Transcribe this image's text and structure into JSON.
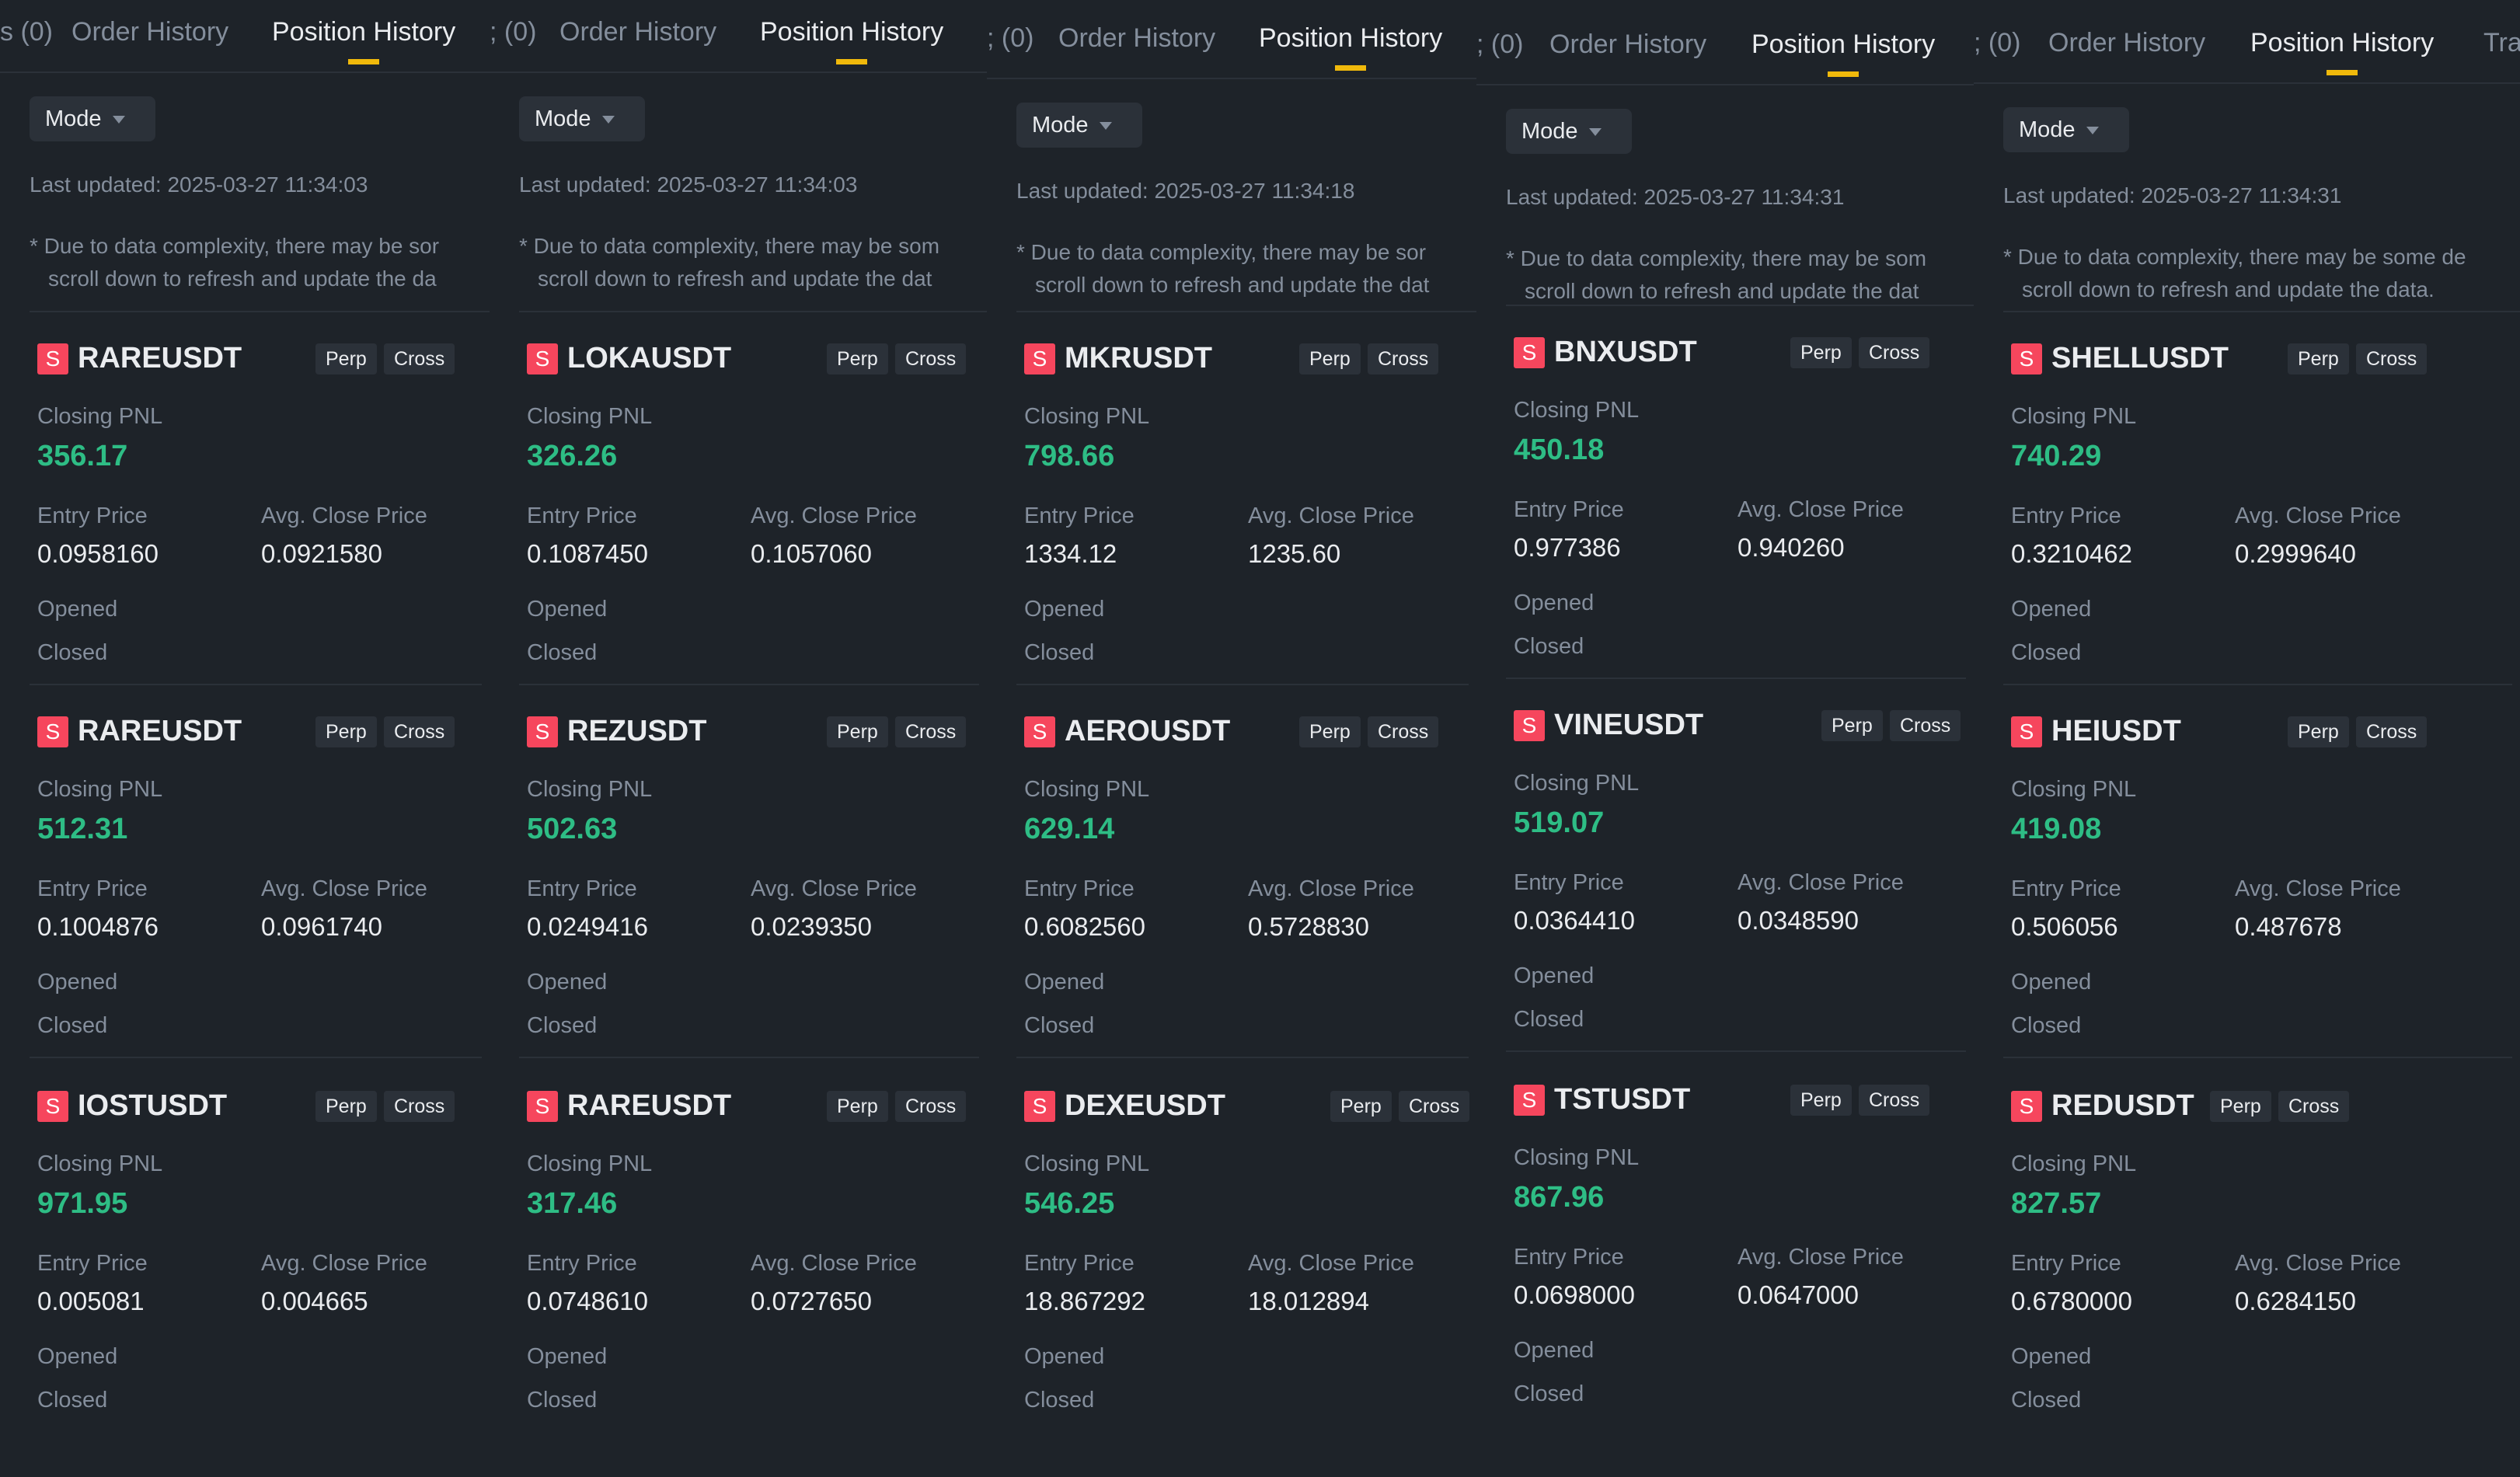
{
  "columns": [
    {
      "tabs": {
        "prev": "s (0)",
        "order": "Order History",
        "position": "Position History",
        "next": ""
      },
      "mode": "Mode",
      "updated": "Last updated: 2025-03-27 11:34:03",
      "note1": "* Due to data complexity, there may be sor",
      "note2": "scroll down to refresh and update the da",
      "cards": [
        {
          "symbol": "RAREUSDT",
          "perp": "Perp",
          "cross": "Cross",
          "closing_pnl_label": "Closing PNL",
          "pnl": "356.17",
          "entry_label": "Entry Price",
          "avg_label": "Avg. Close Price",
          "entry": "0.0958160",
          "avg": "0.0921580",
          "opened": "Opened",
          "closed": "Closed"
        },
        {
          "symbol": "RAREUSDT",
          "perp": "Perp",
          "cross": "Cross",
          "closing_pnl_label": "Closing PNL",
          "pnl": "512.31",
          "entry_label": "Entry Price",
          "avg_label": "Avg. Close Price",
          "entry": "0.1004876",
          "avg": "0.0961740",
          "opened": "Opened",
          "closed": "Closed"
        },
        {
          "symbol": "IOSTUSDT",
          "perp": "Perp",
          "cross": "Cross",
          "closing_pnl_label": "Closing PNL",
          "pnl": "971.95",
          "entry_label": "Entry Price",
          "avg_label": "Avg. Close Price",
          "entry": "0.005081",
          "avg": "0.004665",
          "opened": "Opened",
          "closed": "Closed"
        }
      ]
    },
    {
      "tabs": {
        "prev": "; (0)",
        "order": "Order History",
        "position": "Position History",
        "next": ""
      },
      "mode": "Mode",
      "updated": "Last updated: 2025-03-27 11:34:03",
      "note1": "* Due to data complexity, there may be som",
      "note2": "scroll down to refresh and update the dat",
      "cards": [
        {
          "symbol": "LOKAUSDT",
          "perp": "Perp",
          "cross": "Cross",
          "closing_pnl_label": "Closing PNL",
          "pnl": "326.26",
          "entry_label": "Entry Price",
          "avg_label": "Avg. Close Price",
          "entry": "0.1087450",
          "avg": "0.1057060",
          "opened": "Opened",
          "closed": "Closed"
        },
        {
          "symbol": "REZUSDT",
          "perp": "Perp",
          "cross": "Cross",
          "closing_pnl_label": "Closing PNL",
          "pnl": "502.63",
          "entry_label": "Entry Price",
          "avg_label": "Avg. Close Price",
          "entry": "0.0249416",
          "avg": "0.0239350",
          "opened": "Opened",
          "closed": "Closed"
        },
        {
          "symbol": "RAREUSDT",
          "perp": "Perp",
          "cross": "Cross",
          "closing_pnl_label": "Closing PNL",
          "pnl": "317.46",
          "entry_label": "Entry Price",
          "avg_label": "Avg. Close Price",
          "entry": "0.0748610",
          "avg": "0.0727650",
          "opened": "Opened",
          "closed": "Closed"
        }
      ]
    },
    {
      "tabs": {
        "prev": "; (0)",
        "order": "Order History",
        "position": "Position History",
        "next": ""
      },
      "mode": "Mode",
      "updated": "Last updated: 2025-03-27 11:34:18",
      "note1": "* Due to data complexity, there may be sor",
      "note2": "scroll down to refresh and update the dat",
      "cards": [
        {
          "symbol": "MKRUSDT",
          "perp": "Perp",
          "cross": "Cross",
          "closing_pnl_label": "Closing PNL",
          "pnl": "798.66",
          "entry_label": "Entry Price",
          "avg_label": "Avg. Close Price",
          "entry": "1334.12",
          "avg": "1235.60",
          "opened": "Opened",
          "closed": "Closed"
        },
        {
          "symbol": "AEROUSDT",
          "perp": "Perp",
          "cross": "Cross",
          "closing_pnl_label": "Closing PNL",
          "pnl": "629.14",
          "entry_label": "Entry Price",
          "avg_label": "Avg. Close Price",
          "entry": "0.6082560",
          "avg": "0.5728830",
          "opened": "Opened",
          "closed": "Closed"
        },
        {
          "symbol": "DEXEUSDT",
          "perp": "Perp",
          "cross": "Cross",
          "closing_pnl_label": "Closing PNL",
          "pnl": "546.25",
          "entry_label": "Entry Price",
          "avg_label": "Avg. Close Price",
          "entry": "18.867292",
          "avg": "18.012894",
          "opened": "Opened",
          "closed": "Closed"
        }
      ]
    },
    {
      "tabs": {
        "prev": "; (0)",
        "order": "Order History",
        "position": "Position History",
        "next": ""
      },
      "mode": "Mode",
      "updated": "Last updated: 2025-03-27 11:34:31",
      "note1": "* Due to data complexity, there may be som",
      "note2": "scroll down to refresh and update the dat",
      "cards": [
        {
          "symbol": "BNXUSDT",
          "perp": "Perp",
          "cross": "Cross",
          "closing_pnl_label": "Closing PNL",
          "pnl": "450.18",
          "entry_label": "Entry Price",
          "avg_label": "Avg. Close Price",
          "entry": "0.977386",
          "avg": "0.940260",
          "opened": "Opened",
          "closed": "Closed"
        },
        {
          "symbol": "VINEUSDT",
          "perp": "Perp",
          "cross": "Cross",
          "closing_pnl_label": "Closing PNL",
          "pnl": "519.07",
          "entry_label": "Entry Price",
          "avg_label": "Avg. Close Price",
          "entry": "0.0364410",
          "avg": "0.0348590",
          "opened": "Opened",
          "closed": "Closed"
        },
        {
          "symbol": "TSTUSDT",
          "perp": "Perp",
          "cross": "Cross",
          "closing_pnl_label": "Closing PNL",
          "pnl": "867.96",
          "entry_label": "Entry Price",
          "avg_label": "Avg. Close Price",
          "entry": "0.0698000",
          "avg": "0.0647000",
          "opened": "Opened",
          "closed": "Closed"
        }
      ]
    },
    {
      "tabs": {
        "prev": "; (0)",
        "order": "Order History",
        "position": "Position History",
        "next": "Tra"
      },
      "mode": "Mode",
      "updated": "Last updated: 2025-03-27 11:34:31",
      "note1": "* Due to data complexity, there may be some de",
      "note2": "scroll down to refresh and update the data.",
      "cards": [
        {
          "symbol": "SHELLUSDT",
          "perp": "Perp",
          "cross": "Cross",
          "closing_pnl_label": "Closing PNL",
          "pnl": "740.29",
          "entry_label": "Entry Price",
          "avg_label": "Avg. Close Price",
          "entry": "0.3210462",
          "avg": "0.2999640",
          "opened": "Opened",
          "closed": "Closed"
        },
        {
          "symbol": "HEIUSDT",
          "perp": "Perp",
          "cross": "Cross",
          "closing_pnl_label": "Closing PNL",
          "pnl": "419.08",
          "entry_label": "Entry Price",
          "avg_label": "Avg. Close Price",
          "entry": "0.506056",
          "avg": "0.487678",
          "opened": "Opened",
          "closed": "Closed"
        },
        {
          "symbol": "REDUSDT",
          "perp": "Perp",
          "cross": "Cross",
          "closing_pnl_label": "Closing PNL",
          "pnl": "827.57",
          "entry_label": "Entry Price",
          "avg_label": "Avg. Close Price",
          "entry": "0.6780000",
          "avg": "0.6284150",
          "opened": "Opened",
          "closed": "Closed"
        }
      ]
    }
  ],
  "short_badge": "S",
  "colors": {
    "background": "#1e2329",
    "profit": "#2ebd85",
    "short": "#f6465d",
    "tab_accent": "#f0b90b",
    "muted": "#848e9c"
  }
}
